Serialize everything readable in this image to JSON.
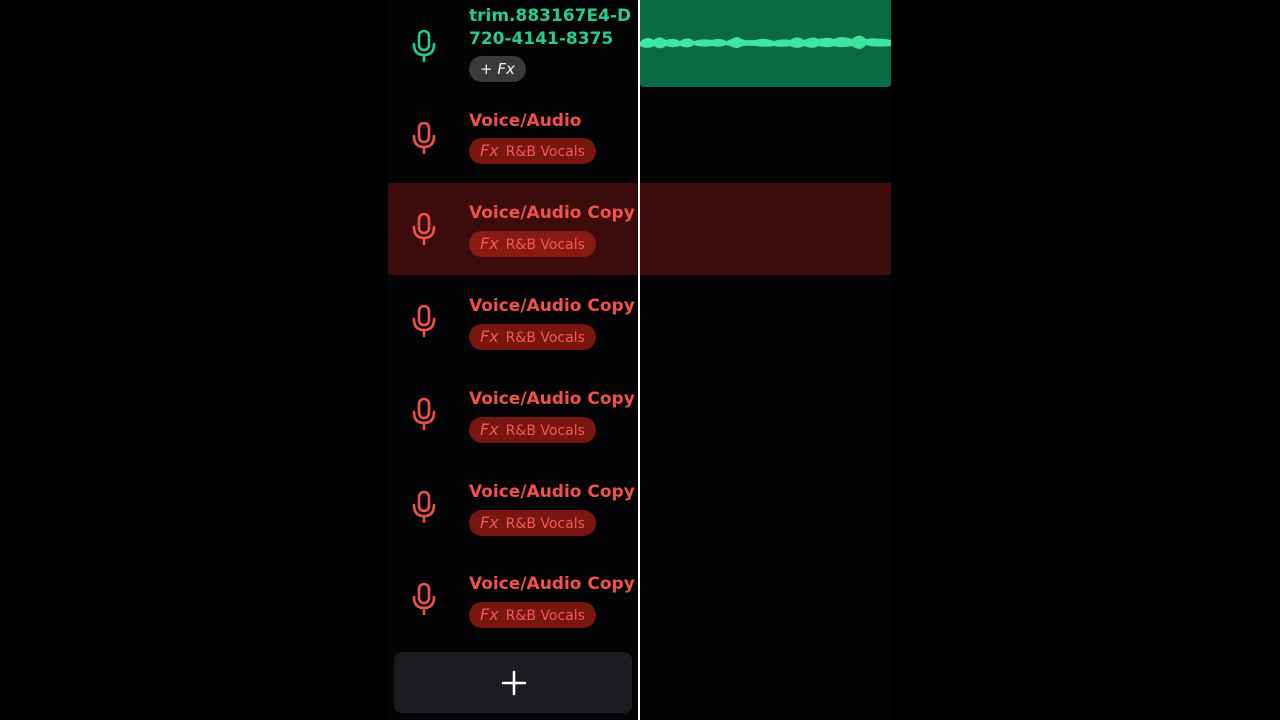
{
  "tracks": [
    {
      "name": "trim.883167E4-D720-4141-8375-…",
      "fx_action": "+ Fx",
      "color": "#24cf8a",
      "selected": false
    },
    {
      "name": "Voice/Audio",
      "fx_tag": "Fx",
      "fx_preset": "R&B Vocals",
      "color": "#f0524a",
      "selected": false
    },
    {
      "name": "Voice/Audio Copy",
      "fx_tag": "Fx",
      "fx_preset": "R&B Vocals",
      "color": "#f0524a",
      "selected": true
    },
    {
      "name": "Voice/Audio Copy",
      "fx_tag": "Fx",
      "fx_preset": "R&B Vocals",
      "color": "#f0524a",
      "selected": false
    },
    {
      "name": "Voice/Audio Copy",
      "fx_tag": "Fx",
      "fx_preset": "R&B Vocals",
      "color": "#f0524a",
      "selected": false
    },
    {
      "name": "Voice/Audio Copy",
      "fx_tag": "Fx",
      "fx_preset": "R&B Vocals",
      "color": "#f0524a",
      "selected": false
    },
    {
      "name": "Voice/Audio Copy",
      "fx_tag": "Fx",
      "fx_preset": "R&B Vocals",
      "color": "#f0524a",
      "selected": false
    }
  ],
  "icons": {
    "track": "microphone-icon",
    "add": "plus-icon"
  },
  "colors": {
    "background": "#040306",
    "selected_row": "#3b0c0b",
    "voice_track": "#f0524a",
    "fx_chip": "#7a1610",
    "imported_track": "#24cf8a",
    "audio_clip": "#0b6a46",
    "waveform": "#3ee6a3",
    "playhead": "#ffffff",
    "add_button": "#1a1c1f"
  }
}
